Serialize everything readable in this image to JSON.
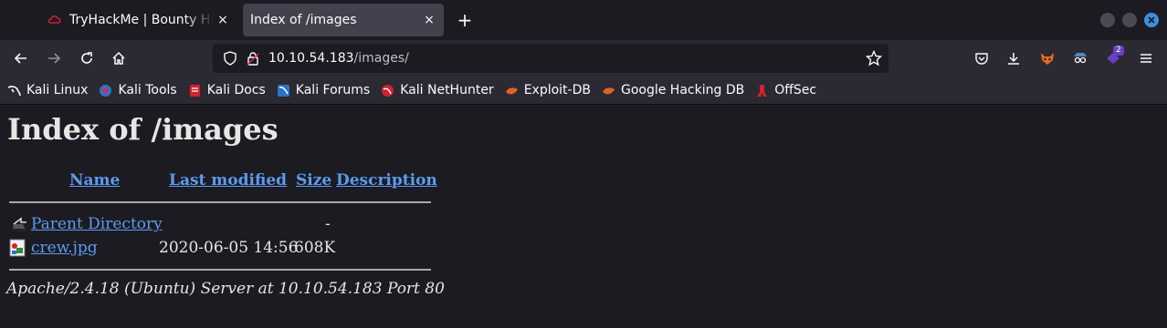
{
  "tabs": [
    {
      "title": "TryHackMe | Bounty Hacker",
      "close": "×",
      "active": false
    },
    {
      "title": "Index of /images",
      "close": "×",
      "active": true
    }
  ],
  "newtab": "+",
  "url": {
    "host": "10.10.54.183",
    "path": "/images/"
  },
  "extensions": {
    "badge": "2"
  },
  "bookmarks": [
    {
      "label": "Kali Linux",
      "icon": "kali-dragon-icon"
    },
    {
      "label": "Kali Tools",
      "icon": "kali-tools-icon"
    },
    {
      "label": "Kali Docs",
      "icon": "kali-docs-icon"
    },
    {
      "label": "Kali Forums",
      "icon": "kali-forums-icon"
    },
    {
      "label": "Kali NetHunter",
      "icon": "kali-nethunter-icon"
    },
    {
      "label": "Exploit-DB",
      "icon": "exploit-db-icon"
    },
    {
      "label": "Google Hacking DB",
      "icon": "ghdb-icon"
    },
    {
      "label": "OffSec",
      "icon": "offsec-icon"
    }
  ],
  "page": {
    "heading": "Index of /images",
    "columns": {
      "name": "Name",
      "modified": "Last modified",
      "size": "Size",
      "description": "Description"
    },
    "rows": [
      {
        "name": "Parent Directory",
        "modified": "",
        "size": "-",
        "description": "",
        "icon": "back-folder-icon"
      },
      {
        "name": "crew.jpg",
        "modified": "2020-06-05 14:56",
        "size": "608K",
        "description": "",
        "icon": "image-file-icon"
      }
    ],
    "footer": "Apache/2.4.18 (Ubuntu) Server at 10.10.54.183 Port 80"
  },
  "colors": {
    "link": "#5c9bee",
    "background": "#1c1b22",
    "toolbar": "#2b2a33"
  }
}
